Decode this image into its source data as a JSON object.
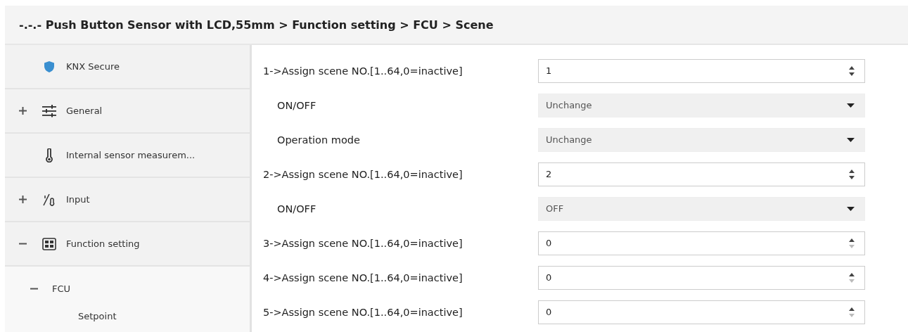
{
  "breadcrumb": "-.-.- Push Button Sensor with LCD,55mm > Function setting > FCU > Scene",
  "sidebar": {
    "items": [
      {
        "label": "KNX Secure",
        "kind": "shield"
      },
      {
        "label": "General",
        "kind": "sliders",
        "expanded": false
      },
      {
        "label": "Internal sensor measurem...",
        "kind": "thermometer"
      },
      {
        "label": "Input",
        "kind": "input",
        "expanded": false
      },
      {
        "label": "Function setting",
        "kind": "grid",
        "expanded": true,
        "children": [
          {
            "label": "FCU",
            "expanded": true,
            "children": [
              {
                "label": "Setpoint"
              }
            ]
          }
        ]
      }
    ]
  },
  "parameters": [
    {
      "kind": "spin",
      "label": "1->Assign scene NO.[1..64,0=inactive]",
      "value": "1",
      "down_disabled": false
    },
    {
      "kind": "select",
      "label": "ON/OFF",
      "value": "Unchange"
    },
    {
      "kind": "select",
      "label": "Operation mode",
      "value": "Unchange"
    },
    {
      "kind": "spin",
      "label": "2->Assign scene NO.[1..64,0=inactive]",
      "value": "2",
      "down_disabled": false
    },
    {
      "kind": "select",
      "label": "ON/OFF",
      "value": "OFF"
    },
    {
      "kind": "spin",
      "label": "3->Assign scene NO.[1..64,0=inactive]",
      "value": "0",
      "down_disabled": true
    },
    {
      "kind": "spin",
      "label": "4->Assign scene NO.[1..64,0=inactive]",
      "value": "0",
      "down_disabled": true
    },
    {
      "kind": "spin",
      "label": "5->Assign scene NO.[1..64,0=inactive]",
      "value": "0",
      "down_disabled": true
    }
  ]
}
